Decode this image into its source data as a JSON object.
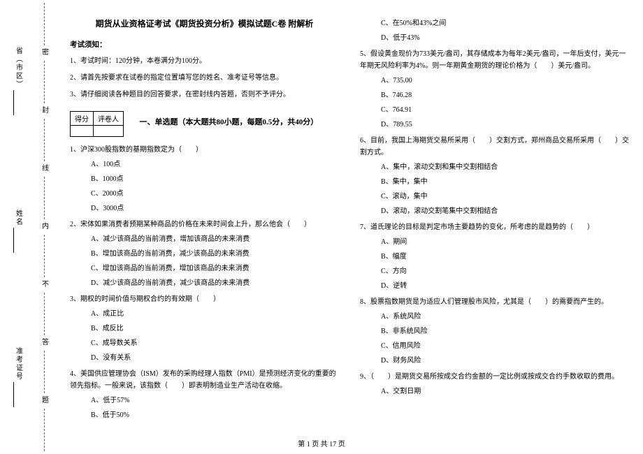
{
  "binding": {
    "labels": [
      "省（市区）",
      "姓名",
      "准考证号"
    ],
    "markers": [
      "密",
      "封",
      "线",
      "内",
      "不",
      "答",
      "题"
    ]
  },
  "title": "期货从业资格证考试《期货投资分析》模拟试题C卷 附解析",
  "notice_header": "考试须知：",
  "notices": [
    "1、考试时间：120分钟，本卷满分为100分。",
    "2、请首先按要求在试卷的指定位置填写您的姓名、准考证号等信息。",
    "3、请仔细阅读各种题目的回答要求，在密封线内答题，否则不予评分。"
  ],
  "score_table": {
    "c1": "得分",
    "c2": "评卷人"
  },
  "section1_title": "一、单选题（本大题共80小题，每题0.5分，共40分）",
  "questions": [
    {
      "stem": "1、沪深300股指数的基期指数定为（　　）",
      "opts": [
        "A、100点",
        "B、1000点",
        "C、2000点",
        "D、3000点"
      ]
    },
    {
      "stem": "2、宋体如果消费者预期某种商品的价格在未来时间会上升，那么他会（　　）",
      "opts": [
        "A、减少该商品的当前消费，增加该商品的未来消费",
        "B、增加该商品的当前消费，减少该商品的未来消费",
        "C、增加该商品的当前消费，增加该商品的未来消费",
        "D、减少该商品的当前消费，减少该商品的未来消费"
      ]
    },
    {
      "stem": "3、期权的时间价值与期权合约的有效期（　　）",
      "opts": [
        "A、成正比",
        "B、成反比",
        "C、成导数关系",
        "D、没有关系"
      ]
    },
    {
      "stem": "4、美国供应管理协会（ISM）发布的采购经理人指数（PMI）是预测经济变化的重要的领先指标。一般来说，该指数（　　）即表明制造业生产活动在收缩。",
      "opts": [
        "A、低于57%",
        "B、低于50%",
        "C、在50%和43%之间",
        "D、低于43%"
      ]
    },
    {
      "stem": "5、假设黄金现价为733美元/盎司，其存储成本为每年2美元/盎司，一年后支付，美元一年期无风险利率为4%。则一年期黄金期货的理论价格为（　　）美元/盎司。",
      "opts": [
        "A、735.00",
        "B、746.28",
        "C、764.91",
        "D、789.55"
      ]
    },
    {
      "stem": "6、目前，我国上海期货交易所采用（　　）交割方式，郑州商品交易所采用（　　）交割方式。",
      "opts": [
        "A、集中，滚动交割和集中交割相结合",
        "B、集中，集中",
        "C、滚动，集中",
        "D、滚动，滚动交割笔集中交割相结合"
      ]
    },
    {
      "stem": "7、道氏理论的目标是判定市场主要趋势的变化，所考虑的是趋势的（　　）",
      "opts": [
        "A、期间",
        "B、幅度",
        "C、方向",
        "D、逆转"
      ]
    },
    {
      "stem": "8、股票指数期货是为适应人们管理股市风险，尤其是（　　）的需要而产生的。",
      "opts": [
        "A、系统风险",
        "B、非系统风险",
        "C、信用风险",
        "D、财务风险"
      ]
    },
    {
      "stem": "9、（　　）是期货交易所按成交合约金额的一定比例或按成交合约手数收取的费用。",
      "opts": [
        "A、交割日期"
      ]
    }
  ],
  "footer": "第 1 页 共 17 页"
}
